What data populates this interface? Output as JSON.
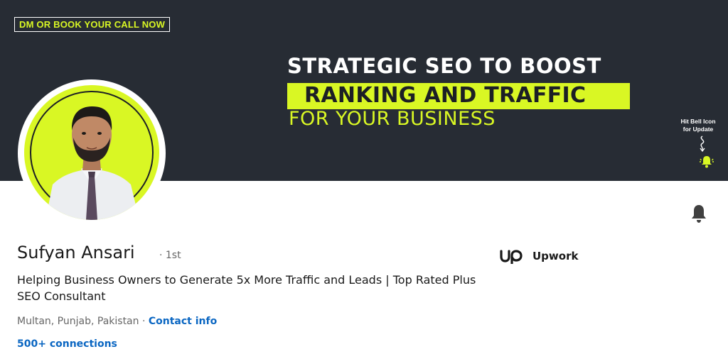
{
  "banner": {
    "cta": "DM OR BOOK YOUR CALL NOW",
    "headline_line1": "STRATEGIC SEO TO BOOST",
    "headline_line2": "RANKING AND TRAFFIC",
    "headline_line3": "FOR YOUR BUSINESS",
    "bell_hint_line1": "Hit Bell Icon",
    "bell_hint_line2": "for Update",
    "accent_color": "#d9f724",
    "background_color": "#272c34"
  },
  "profile": {
    "name": "Sufyan Ansari",
    "degree": "· 1st",
    "headline": "Helping Business Owners to Generate 5x More Traffic and Leads | Top Rated Plus SEO Consultant",
    "location": "Multan, Punjab, Pakistan",
    "separator": " · ",
    "contact_info": "Contact info",
    "connections": "500+ connections"
  },
  "company": {
    "logo_text": "up",
    "name": "Upwork"
  },
  "icons": {
    "notify": "bell-icon",
    "banner_bell": "bell-icon"
  },
  "colors": {
    "link": "#0a66c2",
    "text_primary": "#191919",
    "text_secondary": "#666666"
  }
}
